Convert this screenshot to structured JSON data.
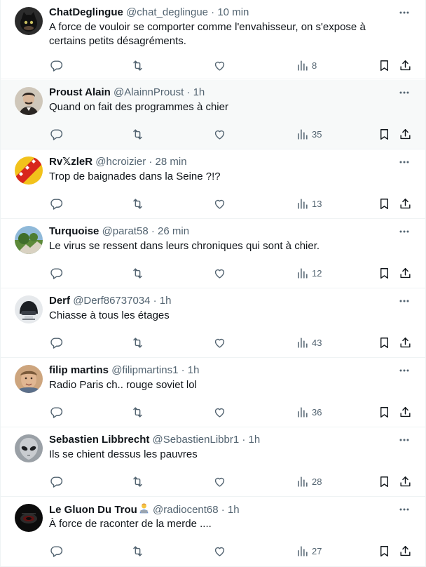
{
  "tweets": [
    {
      "name": "ChatDeglingue",
      "handle": "@chat_deglingue",
      "time": "10 min",
      "text": "A force de vouloir se comporter comme l'envahisseur,  on s'expose à certains petits désagréments.",
      "views": "8",
      "avatar": "avatar-black-cat",
      "highlighted": false
    },
    {
      "name": "Proust Alain",
      "handle": "@AlainnProust",
      "time": "1h",
      "text": "Quand on fait des programmes à chier",
      "views": "35",
      "avatar": "avatar-portrait-proust",
      "highlighted": true
    },
    {
      "name": "Rv𝕏zleR",
      "handle": "@hcroizier",
      "time": "28 min",
      "text": "Trop de baignades dans la Seine ?!?",
      "views": "13",
      "avatar": "avatar-red-yellow-flag",
      "highlighted": false
    },
    {
      "name": "Turquoise",
      "handle": "@parat58",
      "time": "26 min",
      "text": "Le virus se ressent dans leurs chroniques qui sont à chier.",
      "views": "12",
      "avatar": "avatar-landscape",
      "highlighted": false
    },
    {
      "name": "Derf",
      "handle": "@Derf86737034",
      "time": "1h",
      "text": "Chiasse à tous les étages",
      "views": "43",
      "avatar": "avatar-helmet",
      "highlighted": false
    },
    {
      "name": "filip martins",
      "handle": "@filipmartins1",
      "time": "1h",
      "text": "Radio Paris ch.. rouge soviet lol",
      "views": "36",
      "avatar": "avatar-man-face",
      "highlighted": false
    },
    {
      "name": "Sebastien Libbrecht",
      "handle": "@SebastienLibbr1",
      "time": "1h",
      "text": "Ils se chient dessus les pauvres",
      "views": "28",
      "avatar": "avatar-alien",
      "highlighted": false
    },
    {
      "name": "Le Gluon Du Trou",
      "handle": "@radiocent68",
      "time": "1h",
      "text": "À force de raconter de la merde ....",
      "views": "27",
      "avatar": "avatar-dark-logo",
      "highlighted": false,
      "name_emoji": "person-at-laptop-emoji"
    }
  ],
  "separator_dot": "·",
  "icons": {
    "reply": "reply-icon",
    "retweet": "retweet-icon",
    "like": "like-icon",
    "views": "views-icon",
    "bookmark": "bookmark-icon",
    "share": "share-icon",
    "more": "more-icon"
  },
  "colors": {
    "text": "#0f1419",
    "secondary": "#536471",
    "border": "#eff3f4",
    "highlight_bg": "#f7f9f9"
  }
}
